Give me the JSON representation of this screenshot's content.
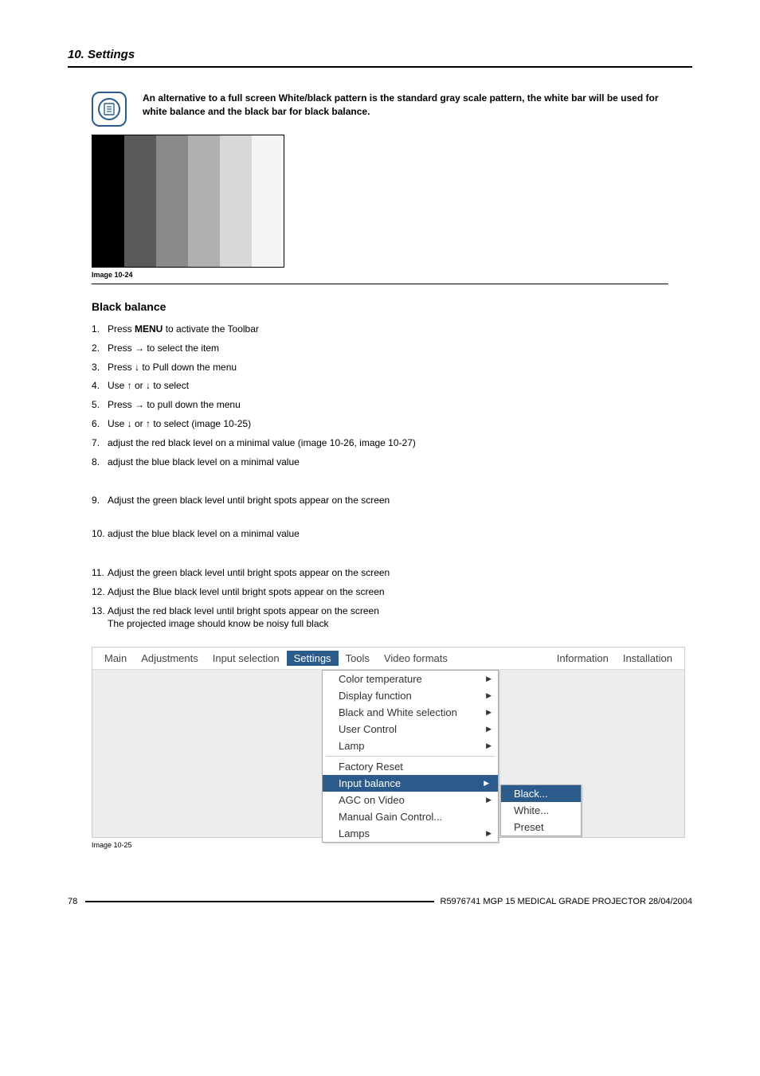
{
  "header": {
    "breadcrumb": "10. Settings"
  },
  "note": {
    "text": "An alternative to a full screen White/black pattern is the standard gray scale pattern, the white bar will be used for white balance and the black bar for black balance."
  },
  "grayscale_caption": "Image 10-24",
  "grayscale_colors": [
    "#000000",
    "#5a5a5a",
    "#8a8a8a",
    "#b0b0b0",
    "#d8d8d8",
    "#f5f5f5"
  ],
  "section_title": "Black balance",
  "steps": {
    "s1_pre": "Press ",
    "s1_bold": "MENU",
    "s1_post": " to activate the Toolbar",
    "s2": "Press → to select the          item",
    "s3": "Press ↓ to Pull down the          menu",
    "s4": "Use ↑ or ↓ to select",
    "s5": "Press → to pull down the menu",
    "s6": "Use ↓ or ↑ to select                      (image 10-25)",
    "s7": "adjust the red black level on a minimal value (image 10-26, image 10-27)",
    "s8": "adjust the blue black level on a minimal value",
    "s9": "Adjust the green black level until bright spots appear on the screen",
    "s10": "adjust the blue black level on a minimal value",
    "s11": "Adjust the green black level until bright spots appear on the screen",
    "s12": "Adjust the Blue black level until bright spots appear on the screen",
    "s13": "Adjust the red black level until bright spots appear on the screen",
    "s13_note": "The projected image should know be noisy full black"
  },
  "menu": {
    "bar": [
      "Main",
      "Adjustments",
      "Input selection",
      "Settings",
      "Tools",
      "Video formats",
      "Information",
      "Installation"
    ],
    "active_index": 3,
    "dropdown": [
      {
        "label": "Color temperature",
        "arrow": true
      },
      {
        "label": "Display function",
        "arrow": true
      },
      {
        "label": "Black and White selection",
        "arrow": true
      },
      {
        "label": "User Control",
        "arrow": true
      },
      {
        "label": "Lamp",
        "arrow": true
      },
      {
        "sep": true
      },
      {
        "label": "Factory Reset",
        "arrow": false
      },
      {
        "label": "Input balance",
        "arrow": true,
        "selected": true
      },
      {
        "label": "AGC on Video",
        "arrow": true
      },
      {
        "label": "Manual Gain Control...",
        "arrow": false
      },
      {
        "label": "Lamps",
        "arrow": true
      }
    ],
    "submenu": [
      {
        "label": "Black...",
        "selected": true
      },
      {
        "label": "White...",
        "selected": false
      },
      {
        "label": "Preset",
        "selected": false
      }
    ]
  },
  "menu_caption": "Image 10-25",
  "footer": {
    "page": "78",
    "text": "R5976741  MGP 15 MEDICAL GRADE PROJECTOR  28/04/2004"
  }
}
